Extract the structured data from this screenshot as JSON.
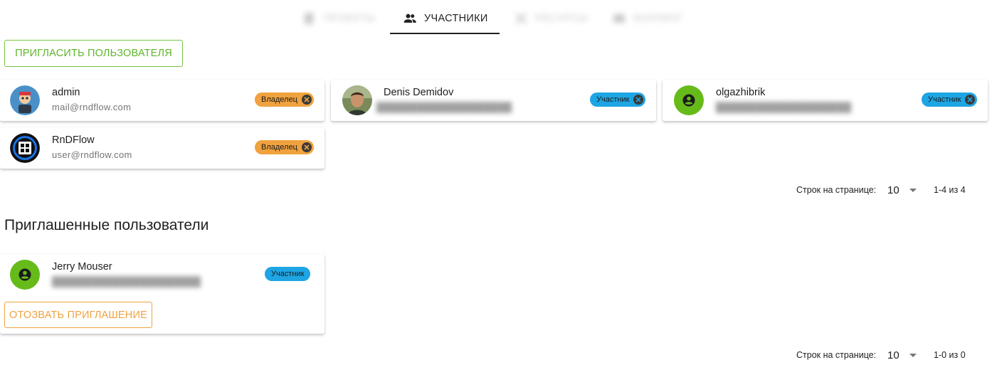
{
  "tabs": [
    {
      "label": "Проекты",
      "icon": "file-icon",
      "blurred": true
    },
    {
      "label": "Участники",
      "icon": "people-icon",
      "active": true
    },
    {
      "label": "Ресурсы",
      "icon": "resources-icon",
      "blurred": true
    },
    {
      "label": "Биллинг",
      "icon": "billing-icon",
      "blurred": true
    }
  ],
  "actions": {
    "invite_label": "ПРИГЛАСИТЬ ПОЛЬЗОВАТЕЛЯ",
    "revoke_label": "ОТОЗВАТЬ ПРИГЛАШЕНИЕ"
  },
  "members": [
    {
      "name": "admin",
      "email": "mail@rndflow.com",
      "role": "Владелец",
      "avatar": "robot-avatar"
    },
    {
      "name": "Denis Demidov",
      "email": "████████████████████",
      "role": "Участник",
      "avatar": "photo-avatar",
      "email_blurred": true
    },
    {
      "name": "olgazhibrik",
      "email": "████████████████████",
      "role": "Участник",
      "avatar": "default-user-avatar",
      "email_blurred": true
    },
    {
      "name": "RnDFlow",
      "email": "user@rndflow.com",
      "role": "Владелец",
      "avatar": "rndflow-logo-avatar"
    }
  ],
  "members_pagination": {
    "rows_label": "Строк на странице:",
    "rows_per_page": "10",
    "range": "1-4 из 4"
  },
  "invited": {
    "title": "Приглашенные пользователи",
    "users": [
      {
        "name": "Jerry Mouser",
        "email": "██████████████████████",
        "role": "Участник",
        "avatar": "default-user-avatar",
        "email_blurred": true
      }
    ]
  },
  "invited_pagination": {
    "rows_label": "Строк на странице:",
    "rows_per_page": "10",
    "range": "1-0 из 0"
  },
  "colors": {
    "owner_chip": "#f0a23f",
    "member_chip": "#1ea5e3",
    "invite_button": "#5fb52c",
    "revoke_button": "#f0a23f",
    "default_avatar": "#66bb1a"
  }
}
